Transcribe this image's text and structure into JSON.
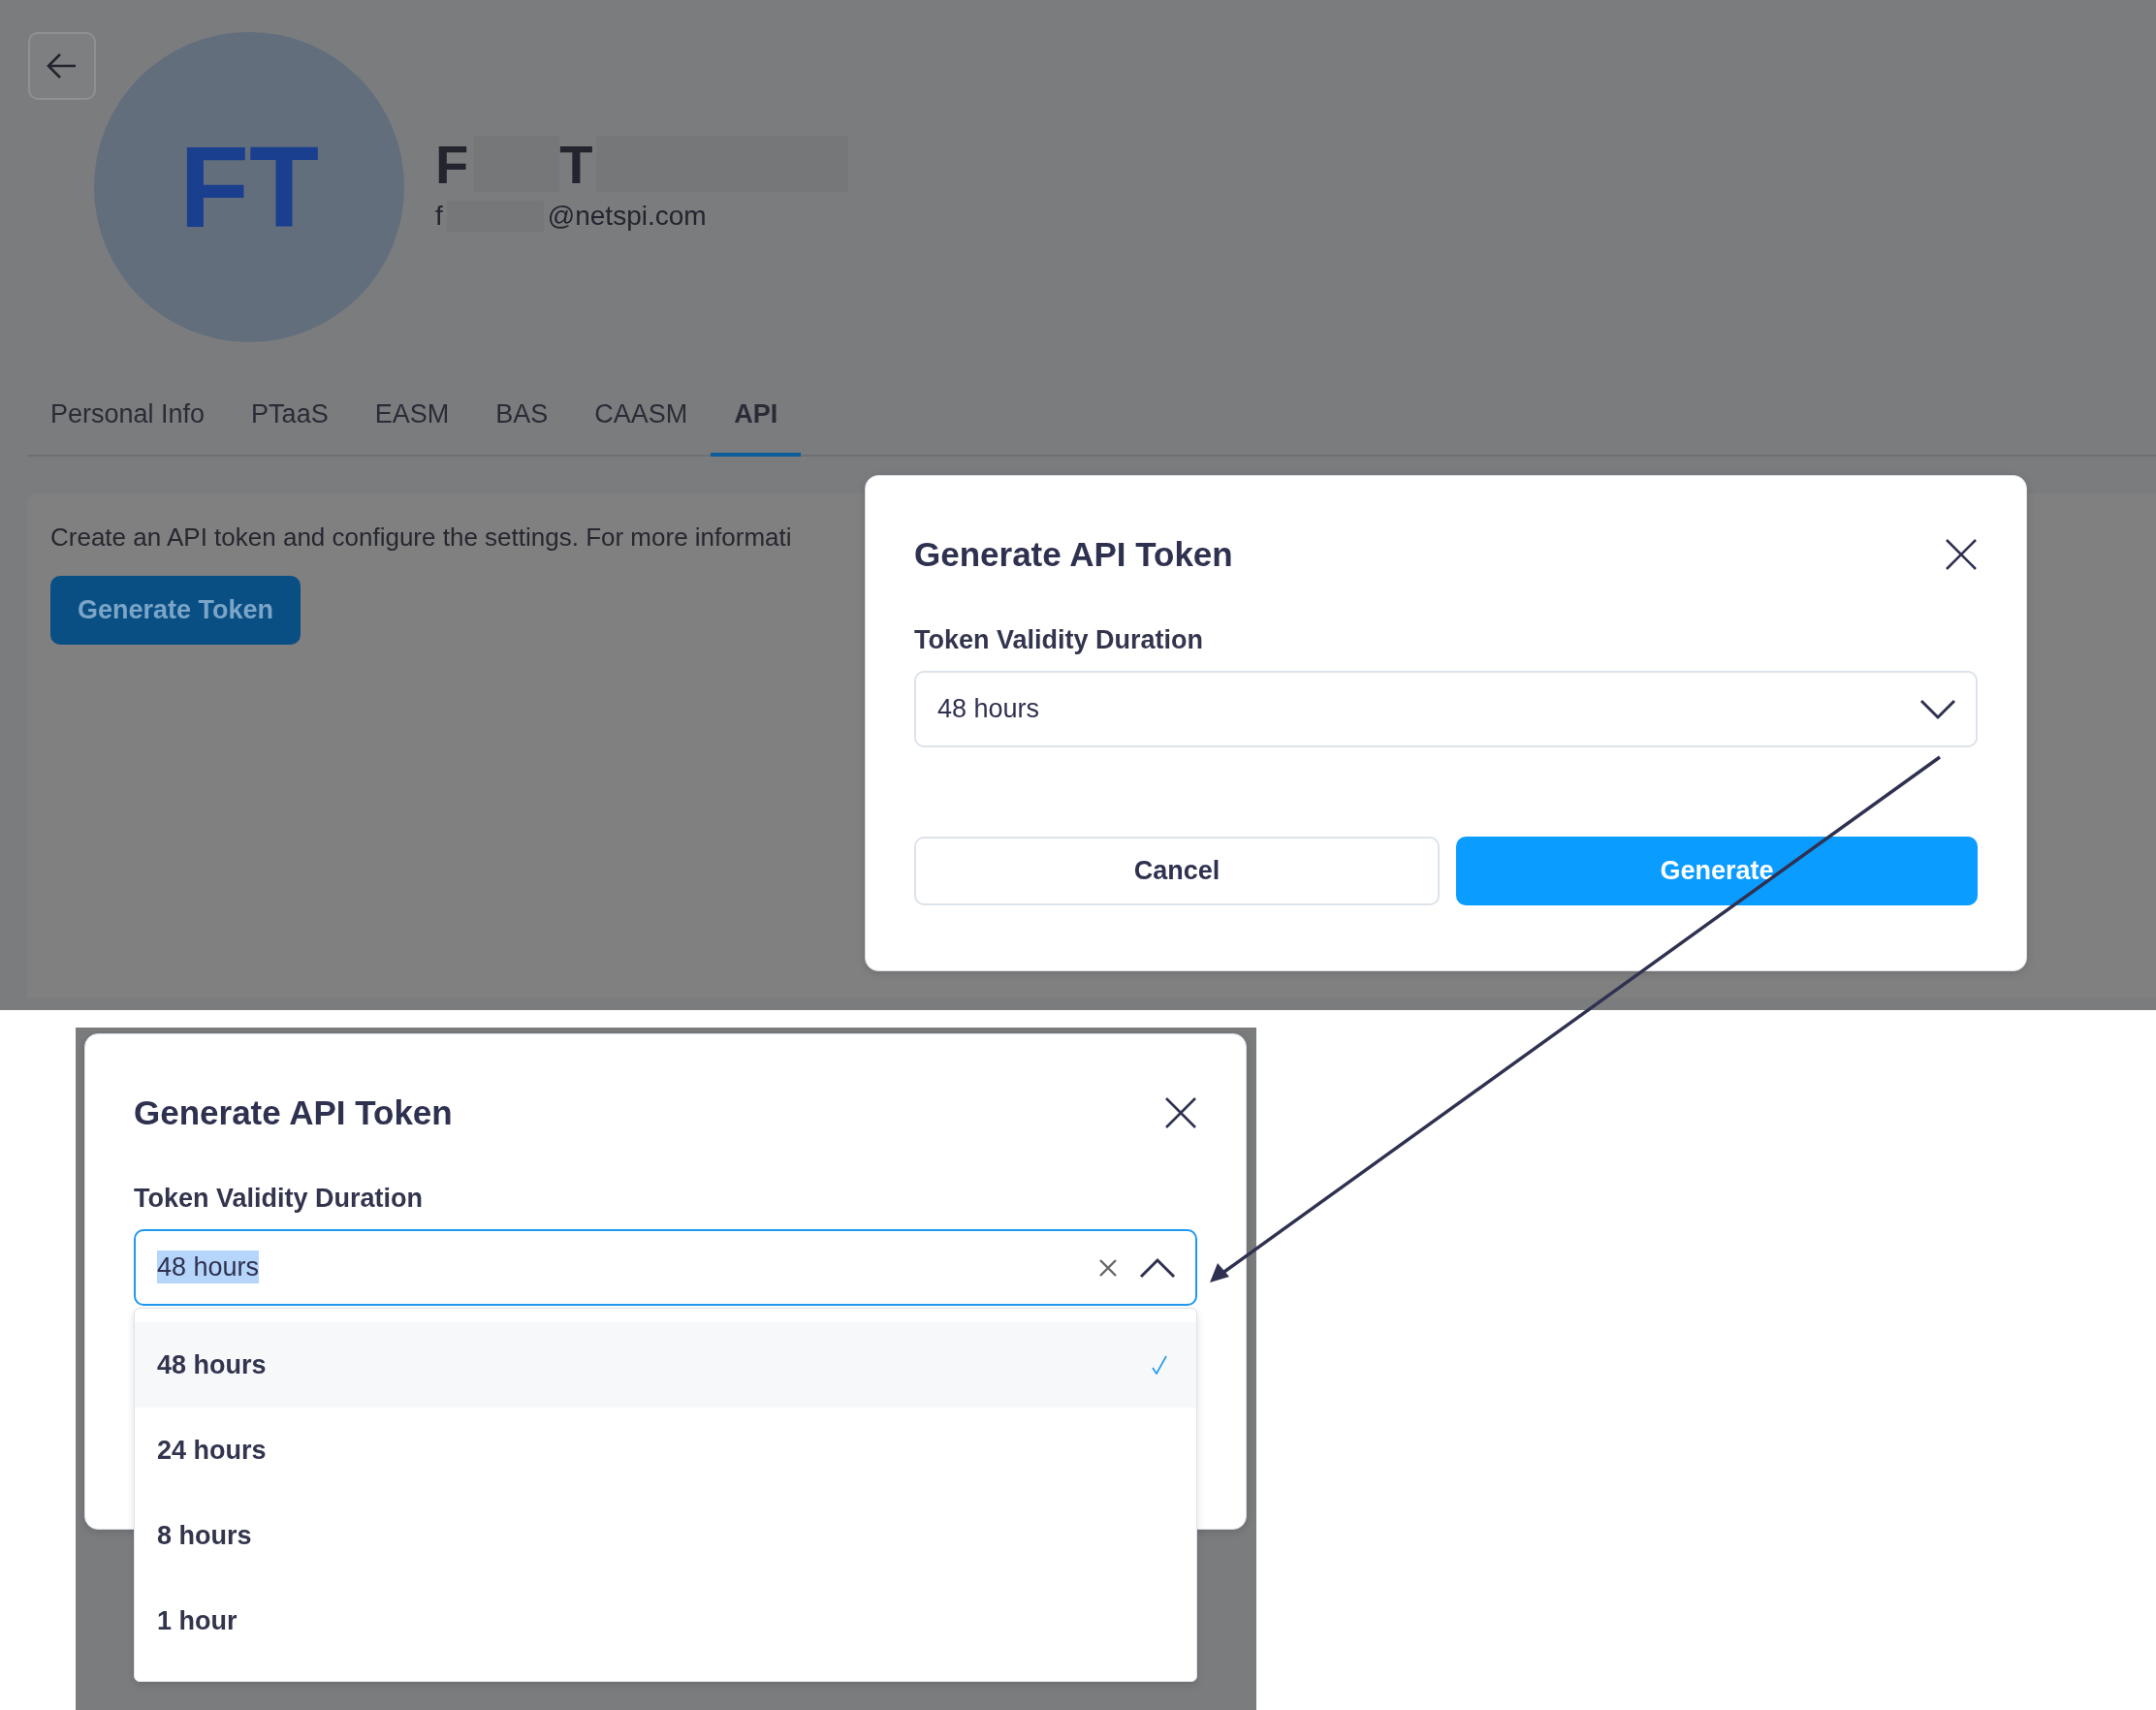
{
  "profile_screen": {
    "avatar_initials": "FT",
    "name_first_initial": "F",
    "name_last_initial": "T",
    "email_first_letter": "f",
    "email_domain": "@netspi.com",
    "tabs": [
      {
        "label": "Personal Info",
        "selected": false
      },
      {
        "label": "PTaaS",
        "selected": false
      },
      {
        "label": "EASM",
        "selected": false
      },
      {
        "label": "BAS",
        "selected": false
      },
      {
        "label": "CAASM",
        "selected": false
      },
      {
        "label": "API",
        "selected": true
      }
    ],
    "description": "Create an API token and configure the settings. For more informati",
    "generate_token_button": "Generate Token",
    "dialog": {
      "title": "Generate API Token",
      "field_label": "Token Validity Duration",
      "value": "48 hours",
      "expanded": false,
      "value_highlighted": false,
      "buttons": [
        {
          "label": "Cancel",
          "kind": "secondary"
        },
        {
          "label": "Generate",
          "kind": "primary"
        }
      ]
    }
  },
  "zoomed_screen": {
    "dialog": {
      "title": "Generate API Token",
      "field_label": "Token Validity Duration",
      "value": "48 hours",
      "expanded": true,
      "value_highlighted": true,
      "options": [
        {
          "label": "48 hours",
          "selected": true
        },
        {
          "label": "24 hours",
          "selected": false
        },
        {
          "label": "8 hours",
          "selected": false
        },
        {
          "label": "1 hour",
          "selected": false
        }
      ]
    }
  }
}
